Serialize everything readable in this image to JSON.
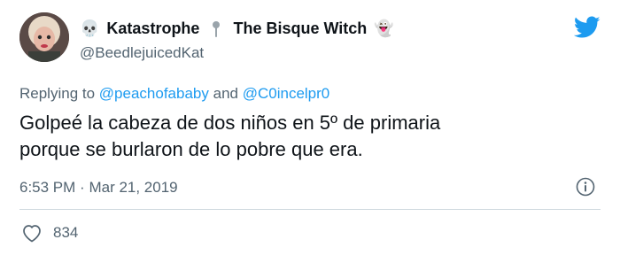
{
  "author": {
    "emoji_skull": "💀",
    "name_part1": "Katastrophe",
    "separator_icon": "pin-icon",
    "name_part2": "The Bisque Witch",
    "emoji_ghost": "👻",
    "handle": "@BeedlejuicedKat"
  },
  "reply": {
    "prefix": "Replying to",
    "mention1": "@peachofababy",
    "conjunction": "and",
    "mention2": "@C0incelpr0"
  },
  "tweet": {
    "line1": "Golpeé la cabeza de dos niños en 5º de primaria",
    "line2": "porque se burlaron de lo pobre que era."
  },
  "meta": {
    "time": "6:53 PM",
    "dot": "·",
    "date": "Mar 21, 2019"
  },
  "actions": {
    "like_count": "834"
  },
  "colors": {
    "accent": "#1d9bf0",
    "text": "#0f1419",
    "muted": "#536471"
  }
}
